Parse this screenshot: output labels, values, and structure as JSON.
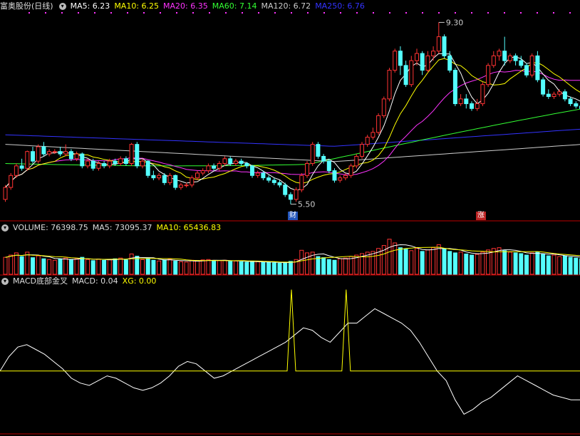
{
  "main_panel": {
    "title": "富奥股份(日线)",
    "toggle_icon": "chevron-down-icon",
    "indicators": [
      {
        "label": "MA5: 6.23",
        "color": "#ffffff"
      },
      {
        "label": "MA10: 6.25",
        "color": "#ffff00"
      },
      {
        "label": "MA20: 6.35",
        "color": "#ff33ff"
      },
      {
        "label": "MA60: 7.14",
        "color": "#33ff33"
      },
      {
        "label": "MA120: 6.72",
        "color": "#cccccc"
      },
      {
        "label": "MA250: 6.76",
        "color": "#3333ff"
      }
    ],
    "high_label": "9.30",
    "low_label": "5.50",
    "badge_cai": "财",
    "badge_zhang": "涨"
  },
  "volume_panel": {
    "title": "VOLUME: 76398.75",
    "ma5": "MA5: 73095.37",
    "ma10": "MA10: 65436.83"
  },
  "macd_panel": {
    "title": "MACD底部金叉",
    "macd": "MACD: 0.04",
    "xg": "XG: 0.00"
  },
  "colors": {
    "up": "#ff3333",
    "down": "#54ffff",
    "ma5": "#ffffff",
    "ma10": "#ffff00",
    "ma20": "#ff33ff",
    "ma60": "#33ff33",
    "ma120": "#cccccc",
    "ma250": "#3333ff",
    "divider": "#bb0000",
    "macd_line": "#ffffff",
    "xg_line": "#ffff00"
  },
  "chart_data": {
    "type": "candlestick",
    "title": "富奥股份(日线)",
    "price_range": [
      5.3,
      9.5
    ],
    "volume_range": [
      0,
      110000
    ],
    "macd_range": [
      -0.25,
      0.35
    ],
    "high": 9.3,
    "low": 5.5,
    "candles": [
      [
        5.6,
        5.85,
        5.55,
        5.9
      ],
      [
        5.85,
        6.1,
        5.8,
        6.15
      ],
      [
        6.1,
        6.3,
        6.05,
        6.35
      ],
      [
        6.3,
        6.25,
        6.2,
        6.45
      ],
      [
        6.25,
        6.6,
        6.2,
        6.62
      ],
      [
        6.6,
        6.4,
        6.35,
        6.7
      ],
      [
        6.4,
        6.7,
        6.35,
        6.75
      ],
      [
        6.7,
        6.55,
        6.5,
        6.8
      ],
      [
        6.55,
        6.6,
        6.5,
        6.65
      ],
      [
        6.6,
        6.6,
        6.55,
        6.65
      ],
      [
        6.6,
        6.55,
        6.5,
        6.7
      ],
      [
        6.55,
        6.6,
        6.5,
        6.75
      ],
      [
        6.6,
        6.45,
        6.4,
        6.65
      ],
      [
        6.45,
        6.55,
        6.4,
        6.6
      ],
      [
        6.55,
        6.3,
        6.25,
        6.58
      ],
      [
        6.3,
        6.4,
        6.25,
        6.45
      ],
      [
        6.4,
        6.25,
        6.2,
        6.45
      ],
      [
        6.25,
        6.35,
        6.2,
        6.4
      ],
      [
        6.35,
        6.3,
        6.25,
        6.4
      ],
      [
        6.3,
        6.4,
        6.25,
        6.45
      ],
      [
        6.4,
        6.35,
        6.3,
        6.45
      ],
      [
        6.35,
        6.45,
        6.3,
        6.5
      ],
      [
        6.45,
        6.35,
        6.3,
        6.5
      ],
      [
        6.35,
        6.75,
        6.3,
        6.78
      ],
      [
        6.75,
        6.3,
        6.25,
        6.8
      ],
      [
        6.3,
        6.4,
        6.25,
        6.45
      ],
      [
        6.4,
        6.1,
        6.05,
        6.42
      ],
      [
        6.1,
        6.05,
        6.0,
        6.2
      ],
      [
        6.05,
        6.1,
        6.0,
        6.15
      ],
      [
        6.1,
        5.95,
        5.9,
        6.15
      ],
      [
        5.95,
        6.1,
        5.9,
        6.15
      ],
      [
        6.1,
        5.85,
        5.8,
        6.12
      ],
      [
        5.85,
        5.9,
        5.8,
        5.95
      ],
      [
        5.9,
        5.9,
        5.85,
        5.95
      ],
      [
        5.9,
        6.05,
        5.85,
        6.1
      ],
      [
        6.05,
        6.15,
        6.0,
        6.2
      ],
      [
        6.15,
        6.2,
        6.1,
        6.25
      ],
      [
        6.2,
        6.3,
        6.15,
        6.35
      ],
      [
        6.3,
        6.25,
        6.2,
        6.35
      ],
      [
        6.25,
        6.35,
        6.2,
        6.4
      ],
      [
        6.35,
        6.45,
        6.3,
        6.5
      ],
      [
        6.45,
        6.35,
        6.3,
        6.5
      ],
      [
        6.35,
        6.4,
        6.3,
        6.45
      ],
      [
        6.4,
        6.35,
        6.3,
        6.45
      ],
      [
        6.35,
        6.3,
        6.25,
        6.38
      ],
      [
        6.3,
        6.1,
        6.05,
        6.32
      ],
      [
        6.1,
        6.15,
        6.05,
        6.2
      ],
      [
        6.15,
        6.05,
        6.0,
        6.2
      ],
      [
        6.05,
        6.0,
        5.95,
        6.1
      ],
      [
        6.0,
        5.95,
        5.9,
        6.05
      ],
      [
        5.95,
        5.9,
        5.85,
        6.0
      ],
      [
        5.9,
        5.7,
        5.65,
        5.95
      ],
      [
        5.7,
        5.6,
        5.5,
        5.75
      ],
      [
        5.6,
        5.8,
        5.55,
        5.85
      ],
      [
        5.8,
        6.1,
        5.75,
        6.15
      ],
      [
        6.1,
        6.35,
        6.05,
        6.4
      ],
      [
        6.35,
        6.75,
        6.3,
        6.8
      ],
      [
        6.75,
        6.5,
        6.45,
        6.8
      ],
      [
        6.5,
        6.4,
        6.35,
        6.55
      ],
      [
        6.4,
        6.2,
        6.15,
        6.45
      ],
      [
        6.2,
        6.0,
        5.95,
        6.25
      ],
      [
        6.0,
        6.05,
        5.95,
        6.1
      ],
      [
        6.05,
        6.1,
        6.0,
        6.15
      ],
      [
        6.1,
        6.3,
        6.05,
        6.35
      ],
      [
        6.3,
        6.5,
        6.25,
        6.55
      ],
      [
        6.5,
        6.75,
        6.45,
        6.8
      ],
      [
        6.75,
        6.9,
        6.7,
        6.95
      ],
      [
        6.9,
        7.0,
        6.85,
        7.1
      ],
      [
        7.0,
        7.35,
        6.95,
        7.4
      ],
      [
        7.35,
        7.7,
        7.3,
        7.75
      ],
      [
        7.7,
        8.3,
        7.65,
        8.35
      ],
      [
        8.3,
        8.7,
        8.25,
        8.75
      ],
      [
        8.7,
        8.4,
        8.2,
        8.8
      ],
      [
        8.4,
        8.0,
        7.95,
        8.5
      ],
      [
        8.0,
        8.5,
        7.95,
        8.6
      ],
      [
        8.5,
        8.65,
        8.4,
        8.75
      ],
      [
        8.65,
        8.3,
        8.2,
        8.7
      ],
      [
        8.3,
        8.6,
        8.25,
        8.7
      ],
      [
        8.6,
        8.7,
        8.5,
        8.8
      ],
      [
        8.7,
        9.0,
        8.65,
        9.3
      ],
      [
        9.0,
        8.6,
        8.55,
        9.05
      ],
      [
        8.6,
        8.3,
        8.25,
        8.7
      ],
      [
        8.3,
        7.6,
        7.55,
        8.35
      ],
      [
        7.6,
        7.7,
        7.55,
        7.8
      ],
      [
        7.7,
        7.6,
        7.5,
        7.8
      ],
      [
        7.6,
        7.5,
        7.45,
        7.65
      ],
      [
        7.5,
        7.6,
        7.45,
        7.7
      ],
      [
        7.6,
        8.0,
        7.55,
        8.05
      ],
      [
        8.0,
        8.4,
        7.95,
        8.45
      ],
      [
        8.4,
        8.6,
        8.35,
        8.7
      ],
      [
        8.6,
        8.7,
        8.5,
        8.75
      ],
      [
        8.7,
        8.5,
        8.4,
        9.0
      ],
      [
        8.5,
        8.6,
        8.45,
        8.65
      ],
      [
        8.6,
        8.5,
        8.4,
        8.65
      ],
      [
        8.5,
        8.4,
        8.35,
        8.6
      ],
      [
        8.4,
        8.2,
        8.15,
        8.45
      ],
      [
        8.2,
        8.6,
        8.15,
        8.65
      ],
      [
        8.6,
        8.1,
        8.05,
        8.7
      ],
      [
        8.1,
        7.8,
        7.75,
        8.15
      ],
      [
        7.8,
        7.75,
        7.7,
        7.9
      ],
      [
        7.75,
        7.8,
        7.7,
        7.85
      ],
      [
        7.8,
        7.85,
        7.75,
        7.9
      ],
      [
        7.85,
        7.7,
        7.65,
        7.9
      ],
      [
        7.7,
        7.6,
        7.55,
        7.75
      ],
      [
        7.6,
        7.55,
        7.5,
        7.65
      ],
      [
        7.55,
        7.5,
        7.4,
        7.6
      ]
    ],
    "volumes": [
      46,
      52,
      58,
      48,
      60,
      45,
      50,
      42,
      40,
      38,
      41,
      44,
      39,
      42,
      46,
      40,
      37,
      41,
      38,
      40,
      42,
      44,
      39,
      55,
      49,
      40,
      43,
      38,
      36,
      39,
      41,
      36,
      34,
      33,
      38,
      37,
      39,
      40,
      36,
      37,
      38,
      35,
      36,
      34,
      33,
      35,
      34,
      33,
      32,
      31,
      30,
      32,
      35,
      40,
      65,
      58,
      60,
      48,
      45,
      40,
      38,
      42,
      44,
      48,
      52,
      56,
      60,
      62,
      70,
      78,
      95,
      85,
      72,
      68,
      64,
      70,
      62,
      66,
      72,
      80,
      68,
      62,
      58,
      60,
      55,
      52,
      54,
      60,
      66,
      70,
      72,
      64,
      60,
      58,
      56,
      52,
      58,
      60,
      54,
      50,
      52,
      48,
      50,
      46,
      44,
      42
    ],
    "macd_values": [
      0.0,
      0.06,
      0.1,
      0.11,
      0.09,
      0.07,
      0.04,
      0.01,
      -0.03,
      -0.05,
      -0.06,
      -0.04,
      -0.02,
      -0.03,
      -0.05,
      -0.07,
      -0.08,
      -0.07,
      -0.05,
      -0.02,
      0.02,
      0.04,
      0.03,
      0.0,
      -0.03,
      -0.02,
      0.0,
      0.02,
      0.04,
      0.06,
      0.08,
      0.1,
      0.12,
      0.15,
      0.18,
      0.17,
      0.14,
      0.12,
      0.16,
      0.2,
      0.2,
      0.23,
      0.26,
      0.24,
      0.22,
      0.2,
      0.17,
      0.12,
      0.06,
      0.0,
      -0.04,
      -0.12,
      -0.18,
      -0.16,
      -0.13,
      -0.11,
      -0.08,
      -0.05,
      -0.02,
      -0.04,
      -0.06,
      -0.08,
      -0.1,
      -0.11,
      -0.12,
      -0.12
    ],
    "xg_signals": [
      {
        "index": 53,
        "value": 1
      },
      {
        "index": 63,
        "value": 1
      }
    ]
  }
}
